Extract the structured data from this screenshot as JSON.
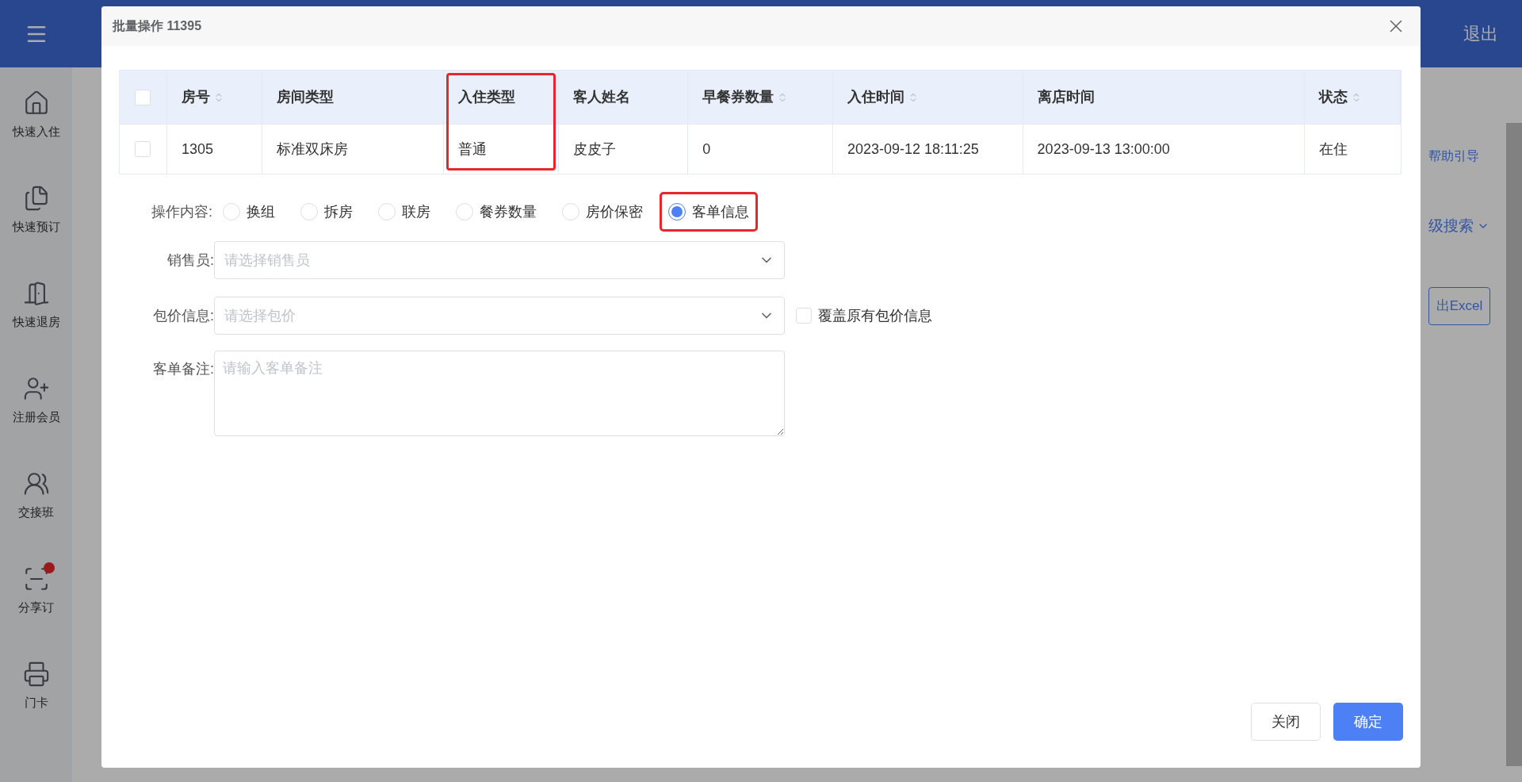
{
  "sidebar": {
    "items": [
      {
        "label": "快速入住",
        "has_badge": false
      },
      {
        "label": "快速预订",
        "has_badge": false
      },
      {
        "label": "快速退房",
        "has_badge": false
      },
      {
        "label": "注册会员",
        "has_badge": false
      },
      {
        "label": "交接班",
        "has_badge": false
      },
      {
        "label": "分享订",
        "has_badge": true
      },
      {
        "label": "门卡",
        "has_badge": false
      }
    ]
  },
  "header": {
    "logout": "退出"
  },
  "background": {
    "help_link": "帮助引导",
    "advanced_search": "级搜索",
    "export_button": "出Excel"
  },
  "dialog": {
    "title": "批量操作 11395",
    "table": {
      "header_checked": false,
      "columns": [
        {
          "label": "房号",
          "sortable": true,
          "highlighted": false
        },
        {
          "label": "房间类型",
          "sortable": false,
          "highlighted": false
        },
        {
          "label": "入住类型",
          "sortable": false,
          "highlighted": true
        },
        {
          "label": "客人姓名",
          "sortable": false,
          "highlighted": false
        },
        {
          "label": "早餐券数量",
          "sortable": true,
          "highlighted": false
        },
        {
          "label": "入住时间",
          "sortable": true,
          "highlighted": false
        },
        {
          "label": "离店时间",
          "sortable": false,
          "highlighted": false
        },
        {
          "label": "状态",
          "sortable": true,
          "highlighted": false
        }
      ],
      "rows": [
        {
          "selected": false,
          "cells": [
            "1305",
            "标准双床房",
            "普通",
            "皮皮子",
            "0",
            "2023-09-12 18:11:25",
            "2023-09-13 13:00:00",
            "在住"
          ]
        }
      ]
    },
    "operation": {
      "label": "操作内容:",
      "options": [
        {
          "label": "换组",
          "selected": false,
          "highlighted": false
        },
        {
          "label": "拆房",
          "selected": false,
          "highlighted": false
        },
        {
          "label": "联房",
          "selected": false,
          "highlighted": false
        },
        {
          "label": "餐券数量",
          "selected": false,
          "highlighted": false
        },
        {
          "label": "房价保密",
          "selected": false,
          "highlighted": false
        },
        {
          "label": "客单信息",
          "selected": true,
          "highlighted": true
        }
      ]
    },
    "salesperson": {
      "label": "销售员:",
      "placeholder": "请选择销售员"
    },
    "package": {
      "label": "包价信息:",
      "placeholder": "请选择包价",
      "overwrite": {
        "label": "覆盖原有包价信息",
        "checked": false
      }
    },
    "note": {
      "label": "客单备注:",
      "placeholder": "请输入客单备注"
    },
    "buttons": [
      {
        "label": "关闭",
        "kind": "secondary"
      },
      {
        "label": "确定",
        "kind": "primary"
      }
    ]
  }
}
